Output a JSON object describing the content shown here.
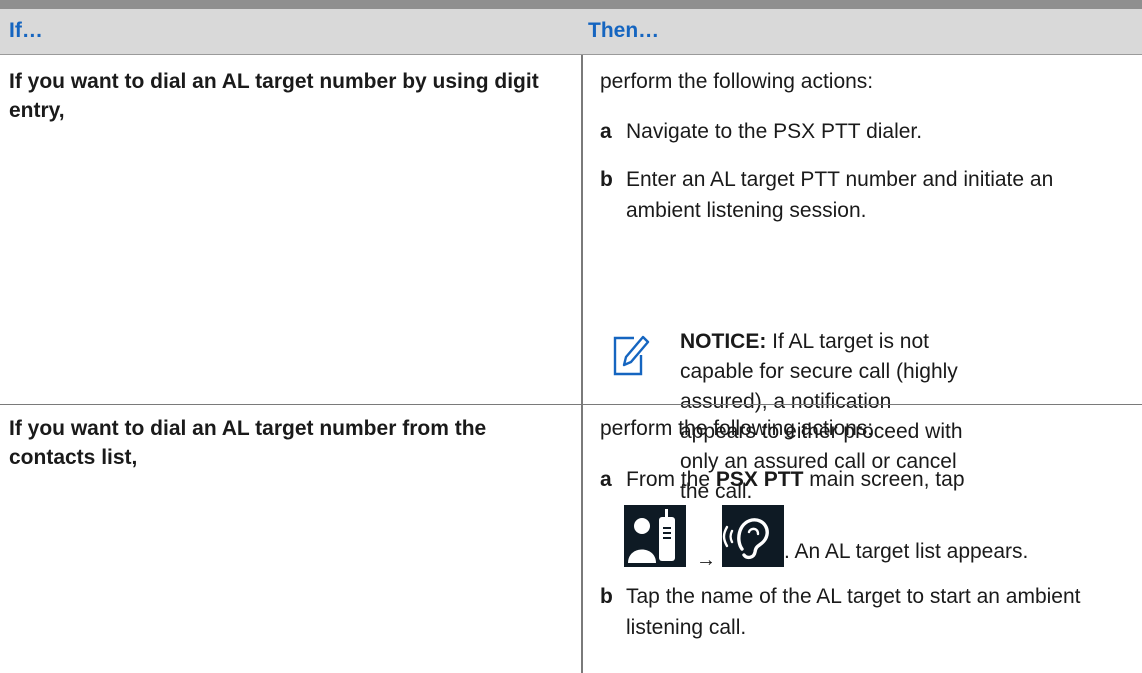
{
  "header": {
    "col_if": "If…",
    "col_then": "Then…"
  },
  "rows": [
    {
      "condition": "If you want to dial an AL target number by using digit entry,",
      "intro": "perform the following actions:",
      "steps": [
        {
          "letter": "a",
          "text": "Navigate to the PSX PTT dialer."
        },
        {
          "letter": "b",
          "text": "Enter an AL target PTT number and initiate an ambient listening session."
        }
      ],
      "notice": {
        "label": "NOTICE:",
        "text": "If AL target is not capable for secure call (highly assured), a notification appears to either proceed with only an assured call or cancel the call."
      }
    },
    {
      "condition": "If you want to dial an AL target number from the contacts list,",
      "intro": "perform the following actions:",
      "steps": [
        {
          "letter": "a",
          "prefix": "From the",
          "app": "PSX PTT",
          "suffix": "main screen, tap",
          "arrow": "→",
          "tail": ". An AL target list appears."
        },
        {
          "letter": "b",
          "text": "Tap the name of the AL target to start an ambient listening call."
        }
      ]
    }
  ],
  "icons": {
    "notice": "pencil-note-icon",
    "contacts": "contacts-radio-icon",
    "ambient": "ambient-listening-icon"
  },
  "colors": {
    "header_text": "#1565c0",
    "header_bg": "#d9d9d9",
    "notice_icon": "#1565c0"
  }
}
